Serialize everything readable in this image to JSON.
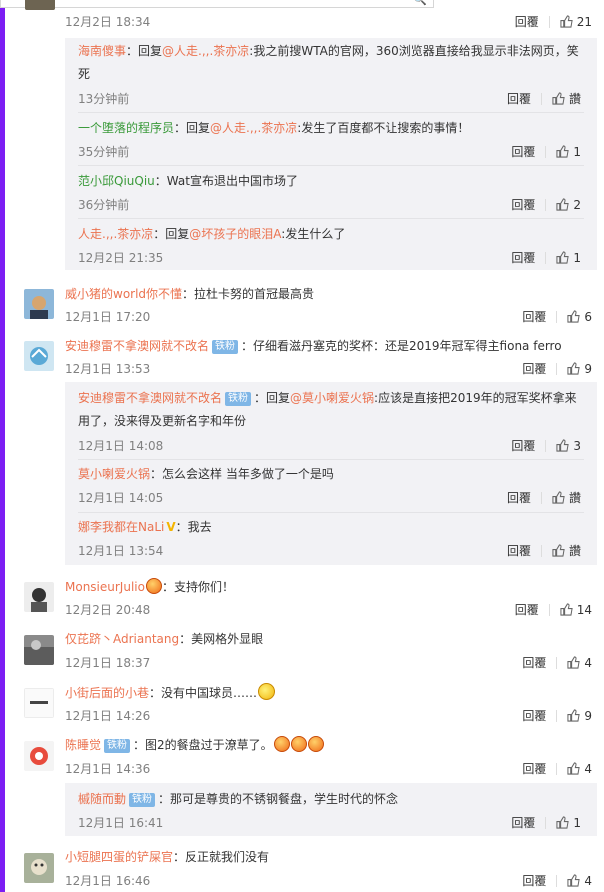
{
  "ui": {
    "reply_label": "回覆",
    "search_icon": "🔍"
  },
  "top_comment": {
    "time": "12月2日 18:34",
    "likes": "21",
    "replies": [
      {
        "name": "海南傻事",
        "prefix": "：回复",
        "at": "@人走.,,.茶亦凉",
        "text": ":我之前搜WTA的官网，360浏览器直接给我显示非法网页，笑死",
        "time": "13分钟前",
        "likes": "讚"
      },
      {
        "name": "一个堕落的程序员",
        "prefix": "：回复",
        "at": "@人走.,,.茶亦凉",
        "text": ":发生了百度都不让搜索的事情！",
        "time": "35分钟前",
        "likes": "1"
      },
      {
        "name": "范小邱QiuQiu",
        "prefix": "：",
        "at": "",
        "text": "Wat宣布退出中国市场了",
        "time": "36分钟前",
        "likes": "2"
      },
      {
        "name": "人走.,,.茶亦凉",
        "prefix": "：回复",
        "at": "@坏孩子的眼泪A",
        "text": ":发生什么了",
        "time": "12月2日 21:35",
        "likes": "1"
      }
    ]
  },
  "comments": [
    {
      "name": "威小猪的world你不懂",
      "badge": "",
      "text": "：拉杜卡努的首冠最高贵",
      "time": "12月1日 17:20",
      "likes": "6"
    },
    {
      "name": "安迪穆雷不拿澳网就不改名",
      "badge": "铁粉",
      "text": "：仔细看滋丹塞克的奖杯：还是2019年冠军得主fiona ferro",
      "time": "12月1日 13:53",
      "likes": "9"
    },
    {
      "name": "MonsieurJulio",
      "badge": "",
      "text": "：支持你们！",
      "time": "12月2日 20:48",
      "likes": "14"
    },
    {
      "name": "仅芘跻丶Adriantang",
      "badge": "",
      "text": "：美网格外显眼",
      "time": "12月1日 18:37",
      "likes": "4"
    },
    {
      "name": "小街后面的小巷",
      "badge": "",
      "text": "：没有中国球员……",
      "time": "12月1日 14:26",
      "likes": "9"
    },
    {
      "name": "陈睡觉",
      "badge": "铁粉",
      "text": "：图2的餐盘过于潦草了。",
      "time": "12月1日 14:36",
      "likes": "4"
    },
    {
      "name": "小短腿四蛋的铲屎官",
      "badge": "",
      "text": "：反正就我们没有",
      "time": "12月1日 16:46",
      "likes": "4"
    }
  ],
  "andy_replies": [
    {
      "name": "安迪穆雷不拿澳网就不改名",
      "badge": "铁粉",
      "prefix": "：回复",
      "at": "@莫小喇爱火锅",
      "text": ":应该是直接把2019年的冠军奖杯拿来用了，没来得及更新名字和年份",
      "time": "12月1日 14:08",
      "likes": "3"
    },
    {
      "name": "莫小喇爱火锅",
      "prefix": "：",
      "at": "",
      "text": "怎么会这样 当年多做了一个是吗",
      "time": "12月1日 14:05",
      "likes": "讚"
    },
    {
      "name": "娜李我都在NaLi",
      "prefix": "：",
      "at": "",
      "text": "我去",
      "time": "12月1日 13:54",
      "likes": "讚"
    }
  ],
  "chen_reply": {
    "name": "槭随而動",
    "badge": "铁粉",
    "text": "：那可是尊贵的不锈钢餐盘，学生时代的怀念",
    "time": "12月1日 16:41",
    "likes": "1"
  },
  "colors": {
    "accent_bar": "#7c1df3",
    "name_color": "#eb7350",
    "badge": "#7fb6e6",
    "reply_bg": "#f2f2f5"
  }
}
